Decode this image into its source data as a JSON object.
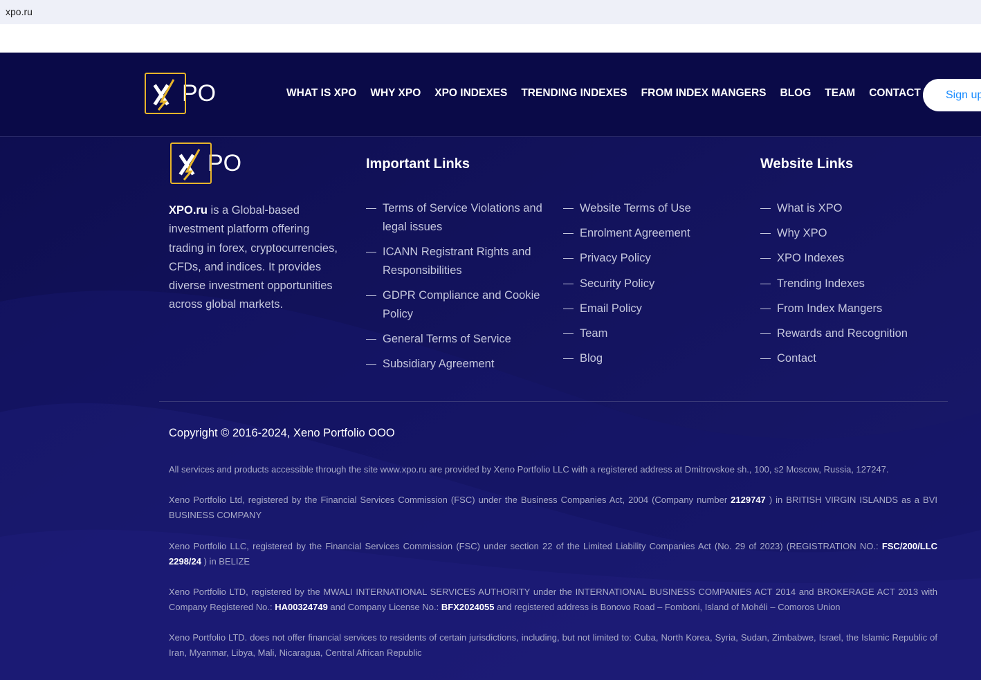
{
  "browser": {
    "url": "xpo.ru"
  },
  "brand": {
    "logo_text": "PO",
    "accent": "#e8b52a",
    "background": "#0d0d4f"
  },
  "nav": {
    "items": [
      "WHAT IS XPO",
      "WHY XPO",
      "XPO INDEXES",
      "TRENDING INDEXES",
      "FROM INDEX MANGERS",
      "BLOG",
      "TEAM",
      "CONTACT"
    ],
    "signup": "Sign up"
  },
  "footer": {
    "about_brand": "XPO.ru",
    "about_text": " is a Global-based investment platform offering trading in forex, cryptocurrencies, CFDs, and indices. It provides diverse investment opportunities across global markets.",
    "important_title": "Important Links",
    "important_links_a": [
      "Terms of Service Violations and legal issues",
      "ICANN Registrant Rights and Responsibilities",
      "GDPR Compliance and Cookie Policy",
      "General Terms of Service",
      "Subsidiary Agreement"
    ],
    "important_links_b": [
      "Website Terms of Use",
      "Enrolment Agreement",
      "Privacy Policy",
      "Security Policy",
      "Email Policy",
      "Team",
      "Blog"
    ],
    "website_title": "Website Links",
    "website_links": [
      "What is XPO",
      "Why XPO",
      "XPO Indexes",
      "Trending Indexes",
      "From Index Mangers",
      "Rewards and Recognition",
      "Contact"
    ],
    "copyright": "Copyright © 2016-2024, Xeno Portfolio OOO",
    "legal_1": "All services and products accessible through the site www.xpo.ru are provided by Xeno Portfolio LLC with a registered address at Dmitrovskoe sh., 100, s2 Moscow, Russia, 127247.",
    "legal_2a": "Xeno Portfolio Ltd, registered by the Financial Services Commission (FSC) under the Business Companies Act, 2004 (Company number ",
    "legal_2b": "2129747",
    "legal_2c": " ) in BRITISH VIRGIN ISLANDS as a BVI BUSINESS COMPANY",
    "legal_3a": "Xeno Portfolio LLC, registered by the Financial Services Commission (FSC) under section 22 of the Limited Liability Companies Act (No. 29 of 2023) (REGISTRATION NO.: ",
    "legal_3b": "FSC/200/LLC 2298/24",
    "legal_3c": " ) in BELIZE",
    "legal_4a": "Xeno Portfolio LTD, registered by the MWALI INTERNATIONAL SERVICES AUTHORITY under the INTERNATIONAL BUSINESS COMPANIES ACT 2014 and BROKERAGE ACT 2013 with Company Registered No.: ",
    "legal_4b": "HA00324749",
    "legal_4c": " and Company License No.: ",
    "legal_4d": "BFX2024055",
    "legal_4e": " and registered address is Bonovo Road – Fomboni, Island of Mohéli – Comoros Union",
    "legal_5": "Xeno Portfolio LTD. does not offer financial services to residents of certain jurisdictions, including, but not limited to: Cuba, North Korea, Syria, Sudan, Zimbabwe, Israel, the Islamic Republic of Iran, Myanmar, Libya, Mali, Nicaragua, Central African Republic"
  }
}
